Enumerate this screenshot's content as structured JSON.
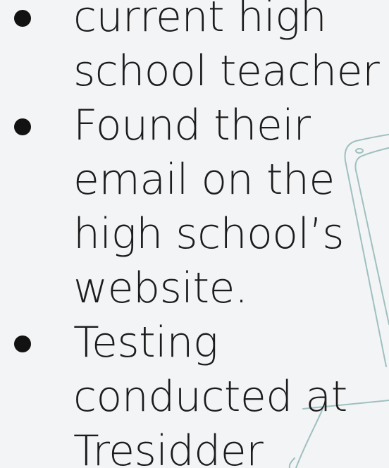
{
  "bullets": [
    {
      "text": "current high school teacher"
    },
    {
      "text": "Found their email on the high school’s website."
    },
    {
      "text": "Testing conducted at Tresidder"
    }
  ],
  "colors": {
    "background": "#f3f4f6",
    "text": "#1c1c1c",
    "bullet": "#121212",
    "sketch": "#9fc0be"
  },
  "icons": [
    "phone-sketch-illustration"
  ]
}
